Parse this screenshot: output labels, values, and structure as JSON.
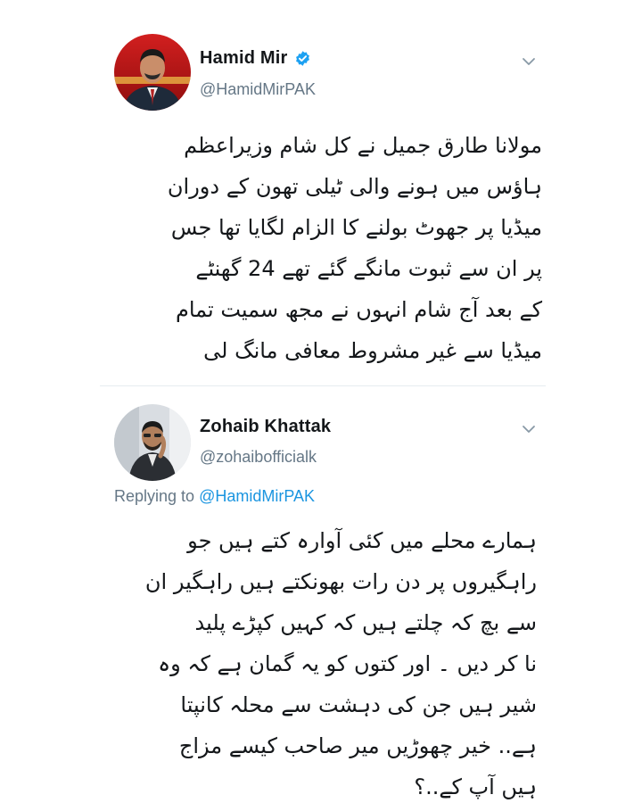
{
  "tweets": [
    {
      "author": {
        "name": "Hamid Mir",
        "handle": "@HamidMirPAK",
        "verified": true
      },
      "lines": [
        "مولانا طارق جمیل نے کل شام وزیراعظم",
        "ہاؤس میں ہونے والی ٹیلی تھون کے دوران",
        "میڈیا پر جھوٹ بولنے کا الزام لگایا تھا جس",
        "پر ان سے ثبوت مانگے گئے تھے 24 گھنٹے",
        "کے بعد آج شام انہوں نے مجھ سمیت تمام",
        "میڈیا سے غیر مشروط معافی مانگ لی"
      ]
    },
    {
      "author": {
        "name": "Zohaib Khattak",
        "handle": "@zohaibofficialk",
        "verified": false
      },
      "replying_prefix": "Replying to",
      "replying_to": "@HamidMirPAK",
      "lines": [
        "ہمارے محلے میں کئی آوارہ کتے ہیں جو",
        "راہگیروں پر دن رات بھونکتے ہیں راہگیر ان",
        "سے بچ کہ چلتے ہیں کہ کہیں کپڑے پلید",
        "نا کر دیں ۔ اور کتوں کو یہ گمان ہے کہ وہ",
        "شیر ہیں جن کی دہشت سے محلہ کانپتا",
        "ہے.. خیر چھوڑیں میر صاحب کیسے مزاج",
        "ہیں آپ کے..؟"
      ]
    }
  ],
  "colors": {
    "text": "#14171a",
    "secondary": "#657786",
    "link": "#1b95e0",
    "verified": "#1da1f2",
    "divider": "#e6ecf0"
  },
  "icons": {
    "verified": "verified-badge-icon",
    "chevron": "chevron-down-icon"
  }
}
